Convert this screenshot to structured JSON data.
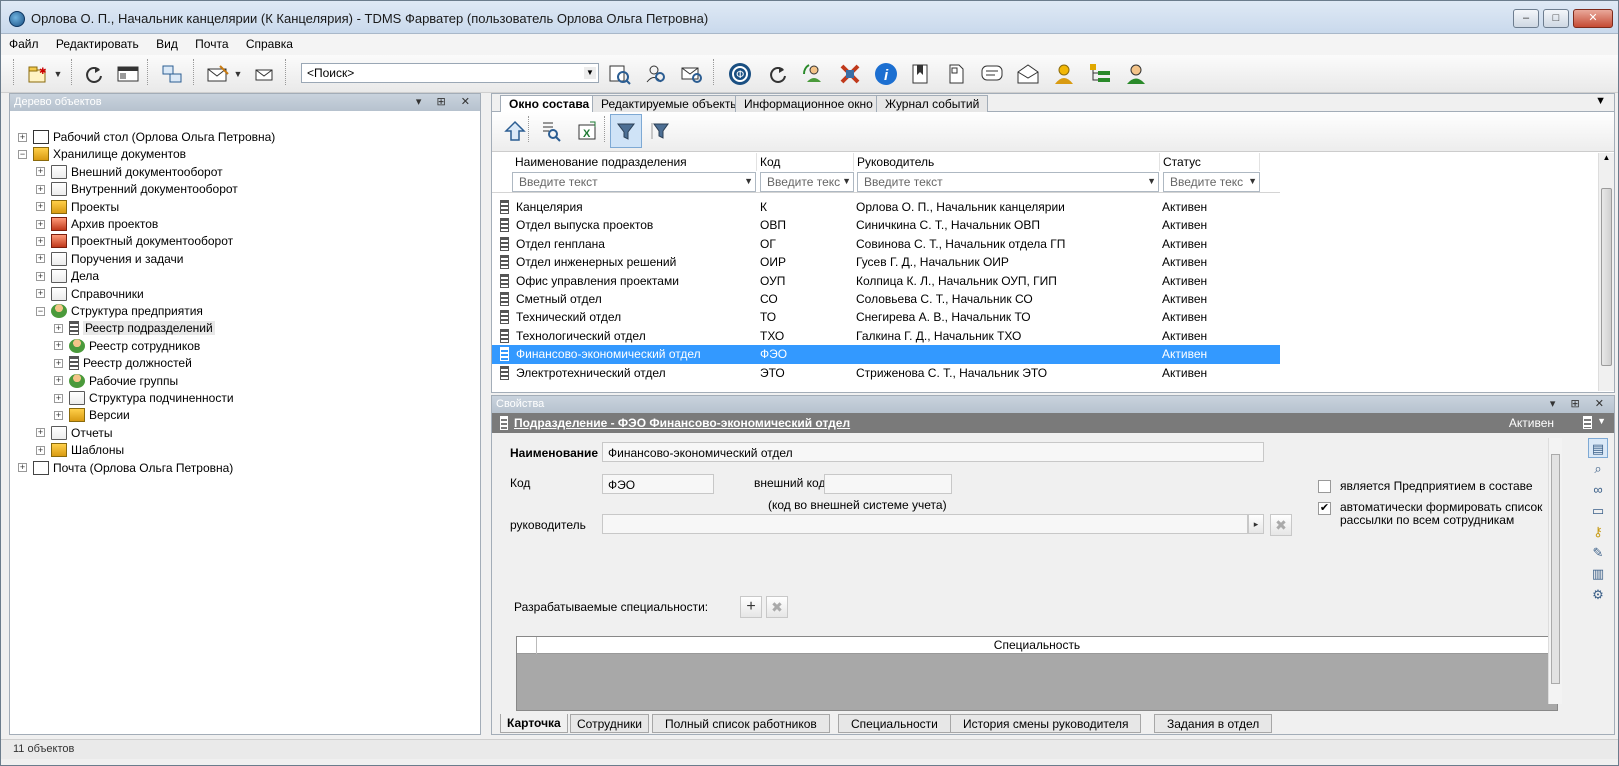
{
  "window": {
    "title": "Орлова О. П., Начальник канцелярии (К Канцелярия) - TDMS Фарватер (пользователь Орлова Ольга Петровна)",
    "btn_min": "–",
    "btn_max": "□",
    "btn_close": "✕"
  },
  "menu": [
    "Файл",
    "Редактировать",
    "Вид",
    "Почта",
    "Справка"
  ],
  "toolbar": {
    "search_value": "<Поиск>"
  },
  "left_panel": {
    "title": "Дерево объектов",
    "ctrl": "▾ ⊞ ✕",
    "tree": [
      {
        "label": "Рабочий стол (Орлова Ольга Петровна)",
        "icon": "desktop-icon",
        "level": 0,
        "pm": "+"
      },
      {
        "label": "Хранилище документов",
        "icon": "storage-icon",
        "level": 0,
        "pm": "−"
      },
      {
        "label": "Внешний документооборот",
        "icon": "folder-icon",
        "level": 1,
        "pm": "+"
      },
      {
        "label": "Внутренний документооборот",
        "icon": "folder-icon",
        "level": 1,
        "pm": "+"
      },
      {
        "label": "Проекты",
        "icon": "projects-icon",
        "level": 1,
        "pm": "+"
      },
      {
        "label": "Архив проектов",
        "icon": "archive-icon",
        "level": 1,
        "pm": "+"
      },
      {
        "label": "Проектный документооборот",
        "icon": "project-docs-icon",
        "level": 1,
        "pm": "+"
      },
      {
        "label": "Поручения и задачи",
        "icon": "folder-icon",
        "level": 1,
        "pm": "+"
      },
      {
        "label": "Дела",
        "icon": "folder-icon",
        "level": 1,
        "pm": "+"
      },
      {
        "label": "Справочники",
        "icon": "folder-icon",
        "level": 1,
        "pm": "+"
      },
      {
        "label": "Структура предприятия",
        "icon": "structure-icon",
        "level": 1,
        "pm": "−"
      },
      {
        "label": "Реестр подразделений",
        "icon": "list-icon",
        "level": 2,
        "pm": "+",
        "selected": true
      },
      {
        "label": "Реестр сотрудников",
        "icon": "people-icon",
        "level": 2,
        "pm": "+"
      },
      {
        "label": "Реестр должностей",
        "icon": "list-icon",
        "level": 2,
        "pm": "+"
      },
      {
        "label": "Рабочие группы",
        "icon": "people-icon",
        "level": 2,
        "pm": "+"
      },
      {
        "label": "Структура подчиненности",
        "icon": "folder-icon",
        "level": 2,
        "pm": "+"
      },
      {
        "label": "Версии",
        "icon": "versions-icon",
        "level": 2,
        "pm": "+"
      },
      {
        "label": "Отчеты",
        "icon": "folder-icon",
        "level": 1,
        "pm": "+"
      },
      {
        "label": "Шаблоны",
        "icon": "templates-icon",
        "level": 1,
        "pm": "+"
      },
      {
        "label": "Почта (Орлова Ольга Петровна)",
        "icon": "mail-icon",
        "level": 0,
        "pm": "+"
      }
    ]
  },
  "tabs": [
    {
      "label": "Окно состава",
      "active": true
    },
    {
      "label": "Редактируемые объекты"
    },
    {
      "label": "Информационное окно"
    },
    {
      "label": "Журнал событий"
    }
  ],
  "tab_close": "✕",
  "tabs_menu": "▼",
  "grid": {
    "columns": [
      "Наименование подразделения",
      "Код",
      "Руководитель",
      "Статус"
    ],
    "filter_placeholders": [
      "Введите текст",
      "Введите текс",
      "Введите текст",
      "Введите текс"
    ],
    "rows": [
      {
        "name": "Канцелярия",
        "code": "К",
        "head": "Орлова О. П., Начальник канцелярии",
        "status": "Активен"
      },
      {
        "name": "Отдел выпуска проектов",
        "code": "ОВП",
        "head": "Синичкина С. Т., Начальник ОВП",
        "status": "Активен"
      },
      {
        "name": "Отдел генплана",
        "code": "ОГ",
        "head": "Совинова С. Т., Начальник отдела ГП",
        "status": "Активен"
      },
      {
        "name": "Отдел инженерных решений",
        "code": "ОИР",
        "head": "Гусев Г. Д., Начальник ОИР",
        "status": "Активен"
      },
      {
        "name": "Офис управления проектами",
        "code": "ОУП",
        "head": "Колпица К. Л., Начальник ОУП, ГИП",
        "status": "Активен"
      },
      {
        "name": "Сметный отдел",
        "code": "СО",
        "head": "Соловьева С. Т., Начальник СО",
        "status": "Активен"
      },
      {
        "name": "Технический отдел",
        "code": "ТО",
        "head": "Снегирева А. В., Начальник ТО",
        "status": "Активен"
      },
      {
        "name": "Технологический отдел",
        "code": "ТХО",
        "head": "Галкина Г. Д., Начальник ТХО",
        "status": "Активен"
      },
      {
        "name": "Финансово-экономический отдел",
        "code": "ФЭО",
        "head": "",
        "status": "Активен",
        "selected": true
      },
      {
        "name": "Электротехнический отдел",
        "code": "ЭТО",
        "head": "Стриженова С. Т., Начальник ЭТО",
        "status": "Активен"
      }
    ]
  },
  "properties": {
    "title": "Свойства",
    "ctrl": "▾ ⊞ ✕",
    "object_title": "Подразделение - ФЭО Финансово-экономический отдел",
    "object_status": "Активен",
    "name_label": "Наименование",
    "name_value": "Финансово-экономический отдел",
    "code_label": "Код",
    "code_value": "ФЭО",
    "ext_code_label": "внешний код",
    "ext_code_value": "",
    "ext_code_hint": "(код во внешней системе учета)",
    "head_label": "руководитель",
    "head_value": "",
    "cb1_label": "является Предприятием в составе",
    "cb1_checked": false,
    "cb2_label": "автоматически формировать список рассылки по всем сотрудникам",
    "cb2_checked": true,
    "spec_label": "Разрабатываемые специальности:",
    "spec_column": "Специальность",
    "bottom_tabs": [
      "Карточка",
      "Сотрудники",
      "Полный список работников",
      "Специальности",
      "История смены руководителя",
      "Задания в отдел"
    ]
  },
  "status_bar": "11 объектов"
}
